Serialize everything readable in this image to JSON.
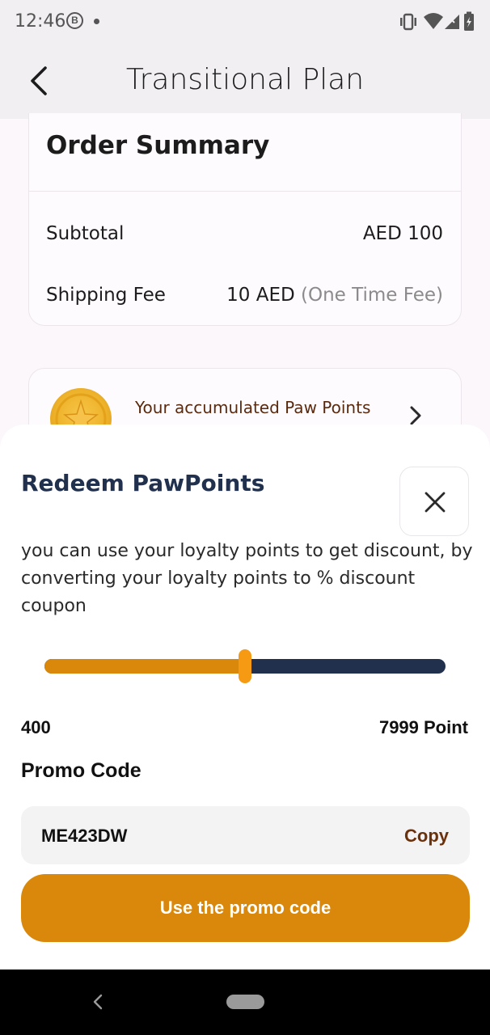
{
  "status_bar": {
    "time": "12:46",
    "badge": "B",
    "icons": [
      "vibrate-icon",
      "wifi-icon",
      "signal-icon",
      "battery-icon"
    ]
  },
  "app_bar": {
    "back_icon": "chevron-left-icon",
    "title": "Transitional Plan"
  },
  "order_summary": {
    "title": "Order Summary",
    "rows": [
      {
        "label": "Subtotal",
        "value": "AED 100",
        "note": ""
      },
      {
        "label": "Shipping Fee",
        "value": "10 AED",
        "note": "(One Time Fee)"
      }
    ]
  },
  "paw_points": {
    "icon": "coin-icon",
    "text": "Your accumulated Paw Points",
    "chevron": "chevron-right-icon"
  },
  "redeem_sheet": {
    "title": "Redeem PawPoints",
    "close_icon": "close-icon",
    "description": "you can use your loyalty points  to get discount, by converting your loyalty points to % discount coupon",
    "slider": {
      "fraction": 0.5,
      "min_label": "400",
      "max_label": "7999 Point"
    },
    "promo_label": "Promo Code",
    "promo_code": "ME423DW",
    "copy_label": "Copy",
    "use_button": "Use the promo code"
  },
  "colors": {
    "accent": "#d9880b",
    "thumb": "#f59a12",
    "navy": "#21304d",
    "brown": "#6b300c"
  },
  "nav_bar": {
    "back_icon": "nav-back-icon",
    "home_icon": "nav-home-pill"
  }
}
